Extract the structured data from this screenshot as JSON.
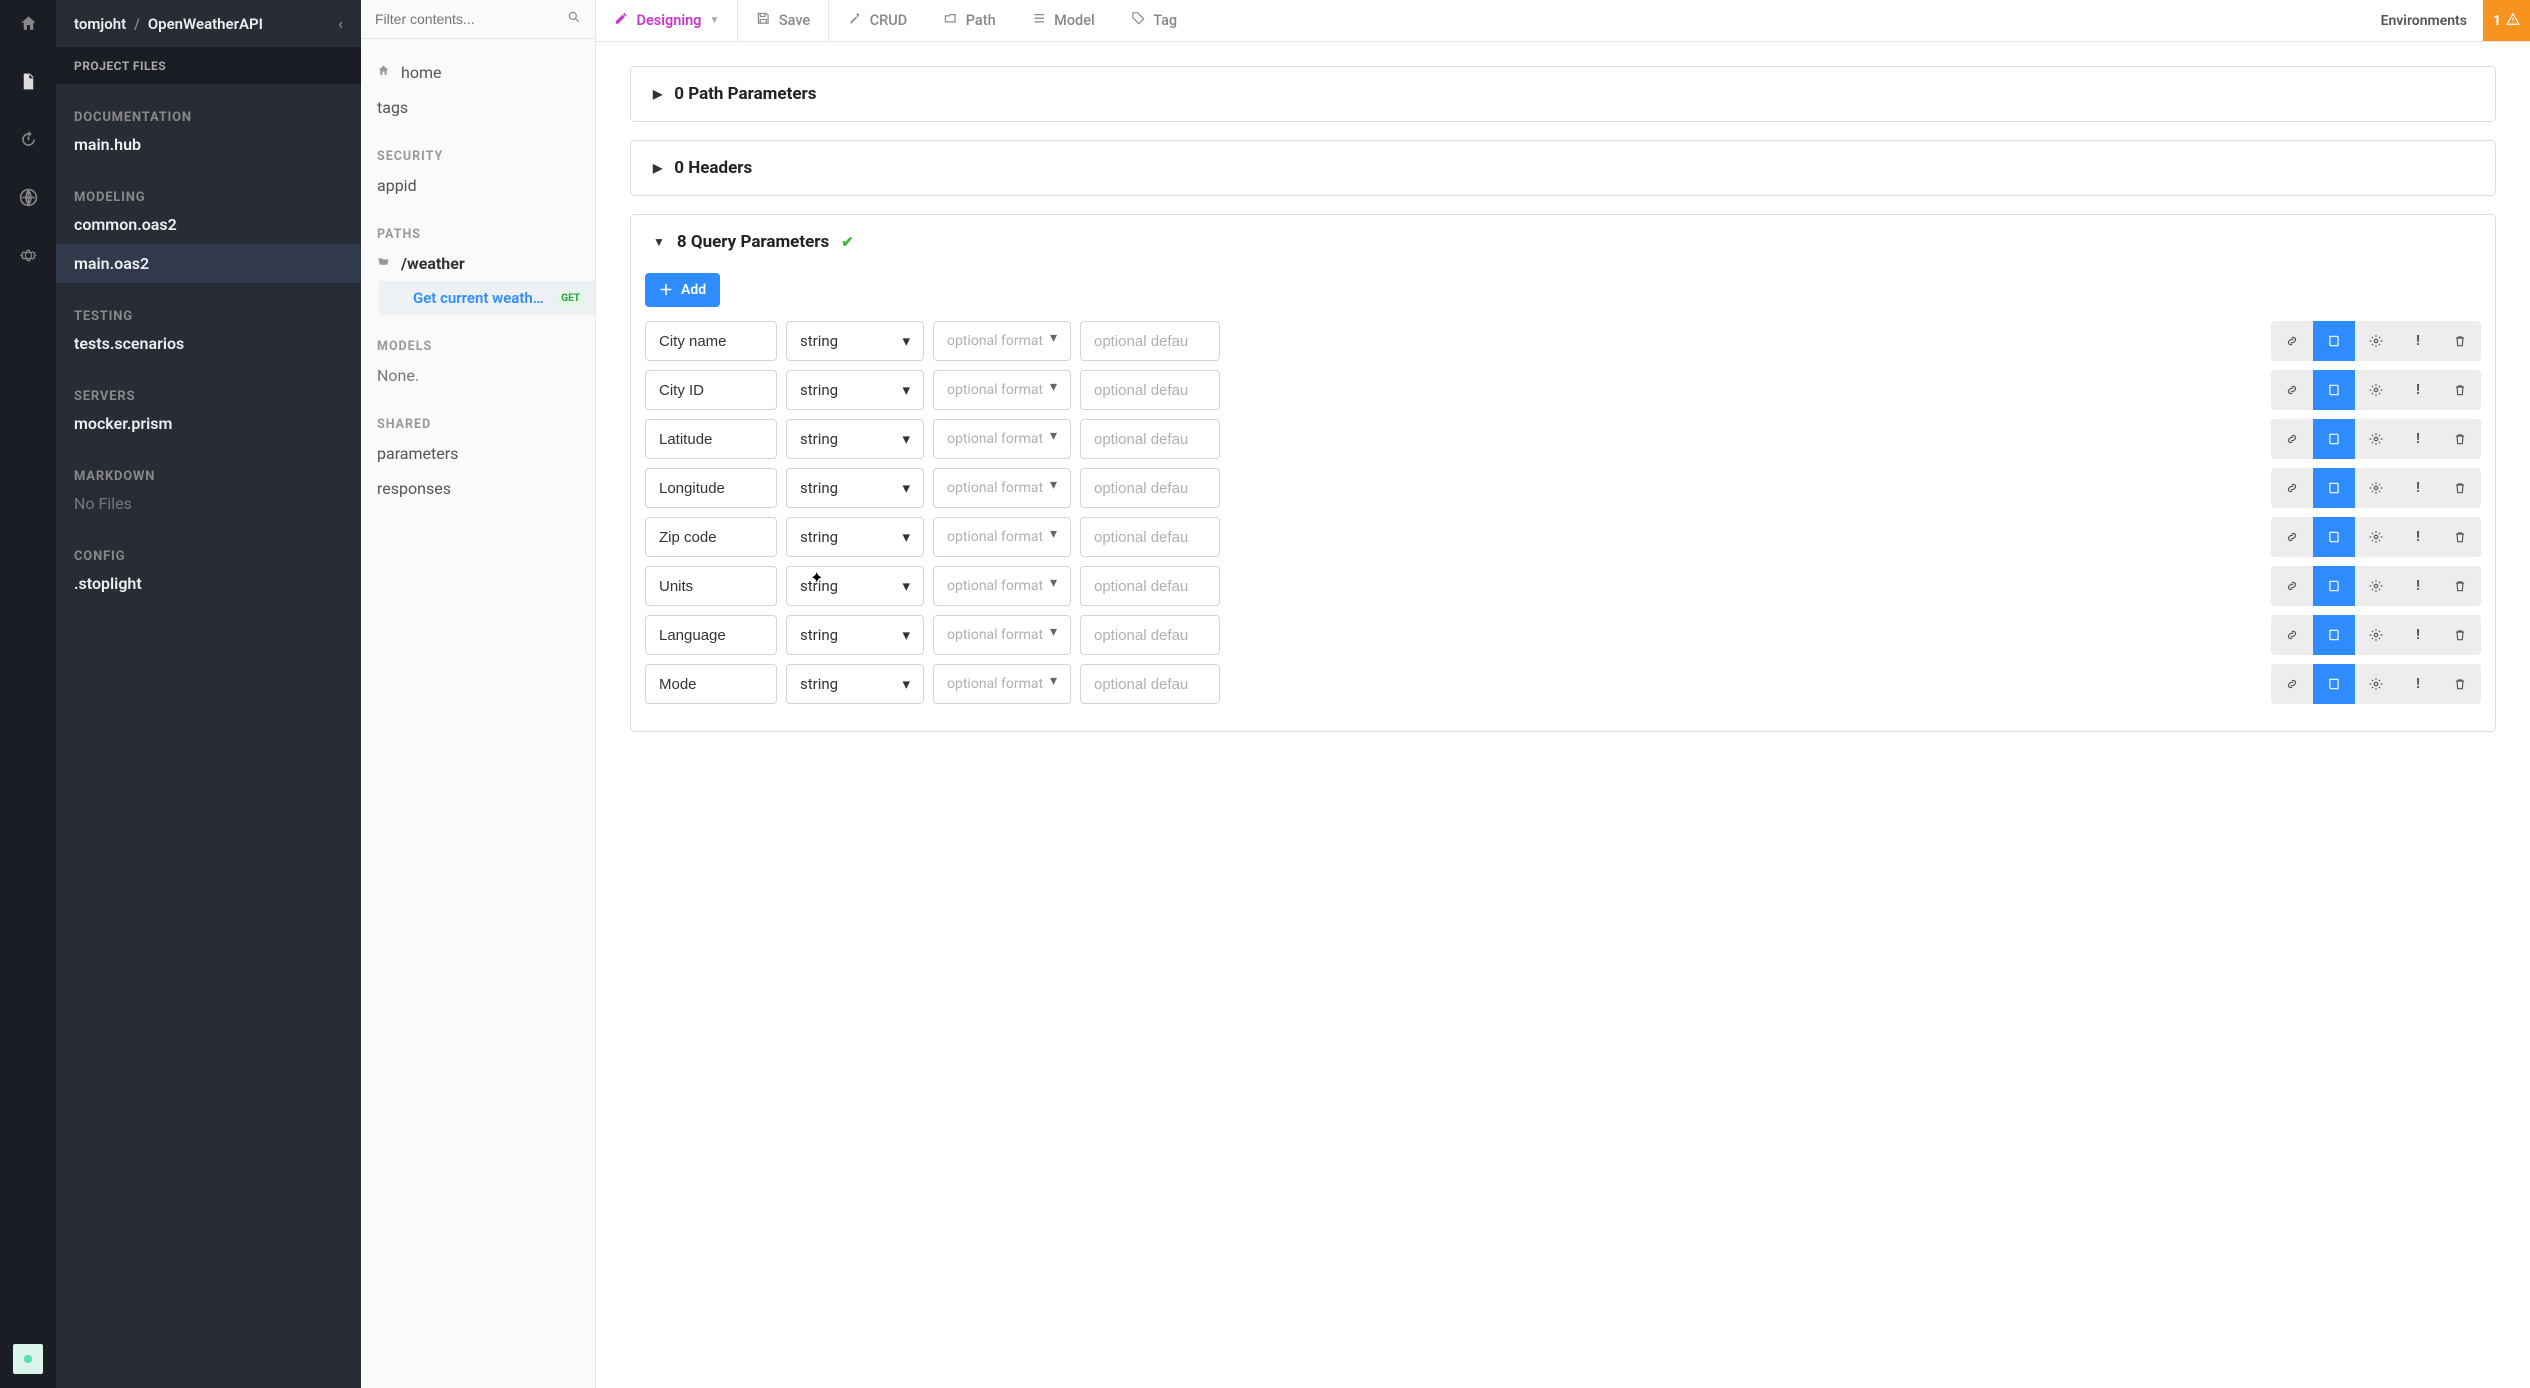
{
  "breadcrumb": {
    "owner": "tomjoht",
    "project": "OpenWeatherAPI"
  },
  "project_files_label": "PROJECT FILES",
  "sidebar": {
    "sections": [
      {
        "label": "DOCUMENTATION",
        "items": [
          "main.hub"
        ]
      },
      {
        "label": "MODELING",
        "items": [
          "common.oas2",
          "main.oas2"
        ],
        "selected": "main.oas2"
      },
      {
        "label": "TESTING",
        "items": [
          "tests.scenarios"
        ]
      },
      {
        "label": "SERVERS",
        "items": [
          "mocker.prism"
        ]
      },
      {
        "label": "MARKDOWN",
        "items": [
          "No Files"
        ],
        "muted": true
      },
      {
        "label": "CONFIG",
        "items": [
          ".stoplight"
        ]
      }
    ]
  },
  "filter": {
    "placeholder": "Filter contents..."
  },
  "mid": {
    "home": "home",
    "tags": "tags",
    "security_label": "SECURITY",
    "security_item": "appid",
    "paths_label": "PATHS",
    "path_name": "/weather",
    "endpoint_label": "Get current weath…",
    "endpoint_method": "GET",
    "models_label": "MODELS",
    "models_empty": "None.",
    "shared_label": "SHARED",
    "shared_parameters": "parameters",
    "shared_responses": "responses"
  },
  "toolbar": {
    "designing": "Designing",
    "save": "Save",
    "crud": "CRUD",
    "path": "Path",
    "model": "Model",
    "tag": "Tag",
    "environments": "Environments",
    "warn_count": "1"
  },
  "panels": {
    "path_params": "0 Path Parameters",
    "headers": "0 Headers",
    "query_params": "8 Query Parameters",
    "add_label": "Add"
  },
  "param_type": "string",
  "param_format_placeholder": "optional format",
  "param_default_placeholder": "optional defau",
  "query_parameters": [
    {
      "name": "City name"
    },
    {
      "name": "City ID"
    },
    {
      "name": "Latitude"
    },
    {
      "name": "Longitude"
    },
    {
      "name": "Zip code"
    },
    {
      "name": "Units"
    },
    {
      "name": "Language"
    },
    {
      "name": "Mode"
    }
  ]
}
